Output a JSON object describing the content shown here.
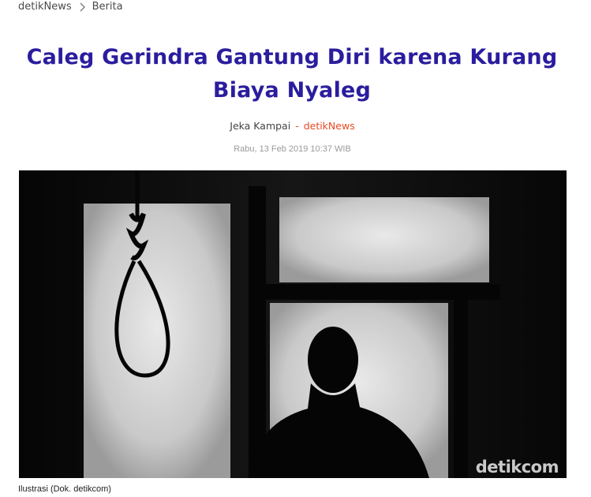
{
  "breadcrumb": {
    "root": "detikNews",
    "section": "Berita"
  },
  "article": {
    "title": "Caleg Gerindra Gantung Diri karena Kurang Biaya Nyaleg",
    "author": "Jeka Kampai",
    "separator": "-",
    "source": "detikNews",
    "date": "Rabu, 13 Feb 2019 10:37 WIB"
  },
  "photo": {
    "watermark": "detikcom",
    "caption": "Ilustrasi (Dok. detikcom)"
  },
  "colors": {
    "title": "#2a1d9e",
    "accent": "#e84a23"
  },
  "icons": {
    "breadcrumb_separator": "chevron-right-icon"
  }
}
